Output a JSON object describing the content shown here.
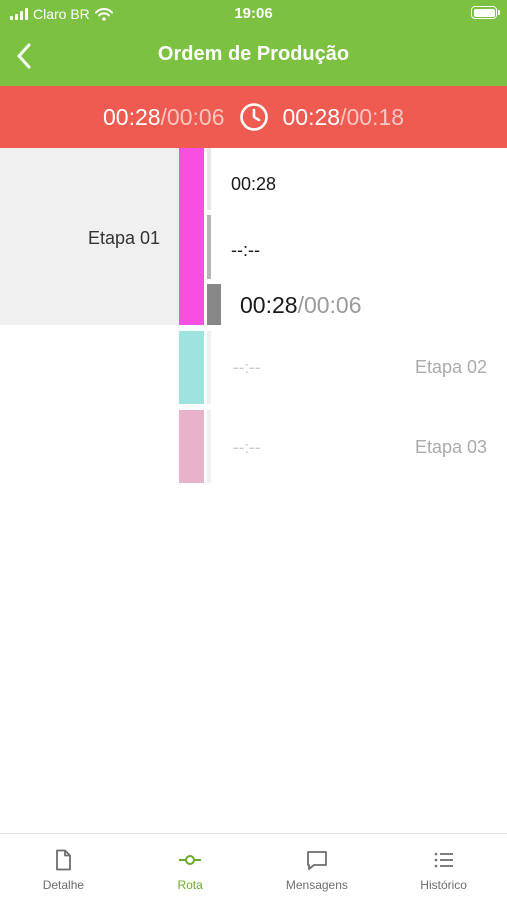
{
  "status_bar": {
    "carrier": "Claro BR",
    "time": "19:06"
  },
  "nav": {
    "title": "Ordem de Produção",
    "back_icon": "chevron-left-icon"
  },
  "timer": {
    "left_elapsed": "00:28",
    "left_total": "/00:06",
    "clock_icon": "clock-icon",
    "right_elapsed": "00:28",
    "right_total": "/00:18"
  },
  "stages": [
    {
      "label": "Etapa 01",
      "color": "#f74fe2",
      "value_top": "00:28",
      "value_mid": "--:--",
      "value_elapsed": "00:28",
      "value_total": "/00:06"
    },
    {
      "label": "Etapa 02",
      "color": "#9ee3df",
      "value": "--:--"
    },
    {
      "label": "Etapa 03",
      "color": "#e8b2cb",
      "value": "--:--"
    }
  ],
  "tabs": [
    {
      "label": "Detalhe",
      "icon": "document-icon"
    },
    {
      "label": "Rota",
      "icon": "route-icon"
    },
    {
      "label": "Mensagens",
      "icon": "message-icon"
    },
    {
      "label": "Histórico",
      "icon": "list-icon"
    }
  ],
  "colors": {
    "header": "#7cc142",
    "timer_bar": "#ef5b50",
    "active_tab": "#6aaa2c"
  }
}
